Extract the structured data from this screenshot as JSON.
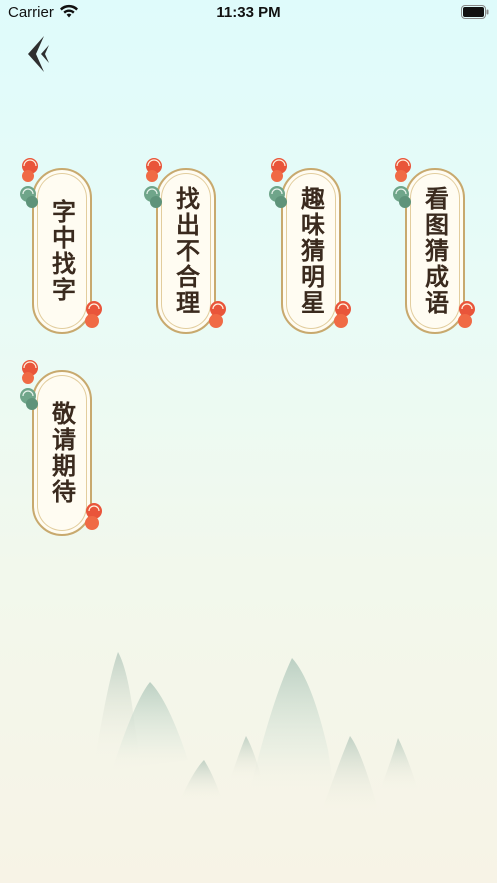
{
  "status_bar": {
    "carrier": "Carrier",
    "time": "11:33 PM",
    "wifi_icon": "wifi-icon",
    "battery_icon": "battery-icon"
  },
  "nav": {
    "back_icon": "back-arrow-icon"
  },
  "games": [
    {
      "label": "字中找字"
    },
    {
      "label": "找出不合理"
    },
    {
      "label": "趣味猜明星"
    },
    {
      "label": "看图猜成语"
    },
    {
      "label": "敬请期待"
    }
  ],
  "colors": {
    "background_top": "#dffbfb",
    "background_bottom": "#f7f3e6",
    "card_fill": "#fffcf2",
    "card_border": "#c8a96e",
    "text": "#3a2a1e",
    "cloud_red": "#e9553a",
    "cloud_green": "#6fa58a",
    "back_icon": "#2f2f2f"
  }
}
